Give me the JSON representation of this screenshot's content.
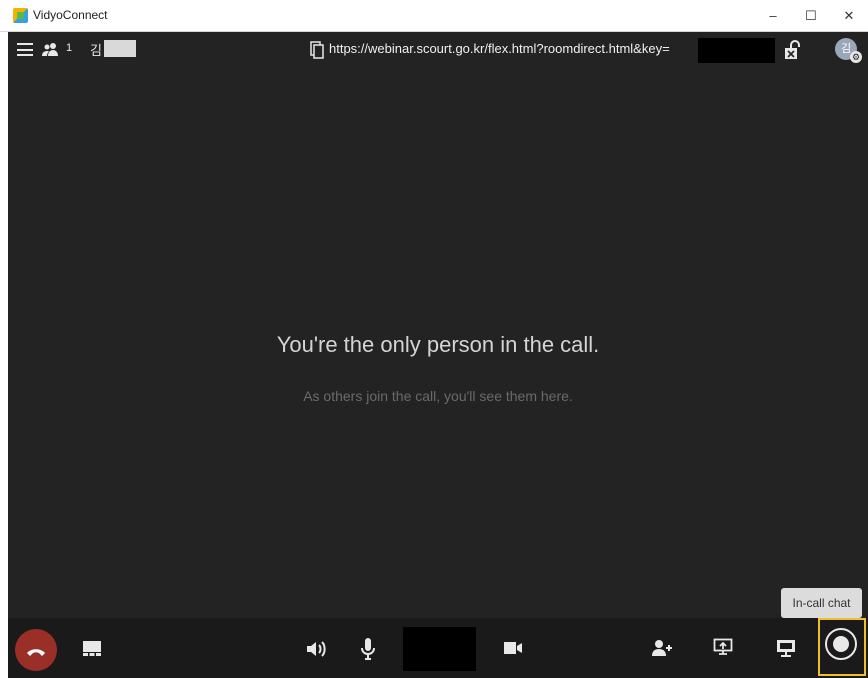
{
  "window": {
    "title": "VidyoConnect",
    "minimize_label": "–",
    "maximize_label": "☐",
    "close_label": "✕"
  },
  "topbar": {
    "participant_count": "1",
    "user_initial": "김",
    "room_url": "https://webinar.scourt.go.kr/flex.html?roomdirect.html&key=",
    "avatar_initial": "김"
  },
  "stage": {
    "title": "You're the only person in the call.",
    "subtitle": "As others join the call, you'll see them here."
  },
  "tooltip": {
    "text": "In-call chat"
  },
  "colors": {
    "background": "#232323",
    "toolbar": "#1a1a1a",
    "end_call": "#9a2f28",
    "highlight": "#f0c02a"
  },
  "icons": {
    "menu": "hamburger-icon",
    "participants": "participants-icon",
    "copy": "copy-icon",
    "lock": "unlock-icon",
    "settings": "gear-icon",
    "end_call": "phone-hangup-icon",
    "layout": "layout-icon",
    "speaker": "speaker-icon",
    "mic": "microphone-icon",
    "camera": "camera-icon",
    "invite": "add-user-icon",
    "share": "share-screen-icon",
    "monitor": "monitor-icon",
    "chat": "chat-icon"
  }
}
